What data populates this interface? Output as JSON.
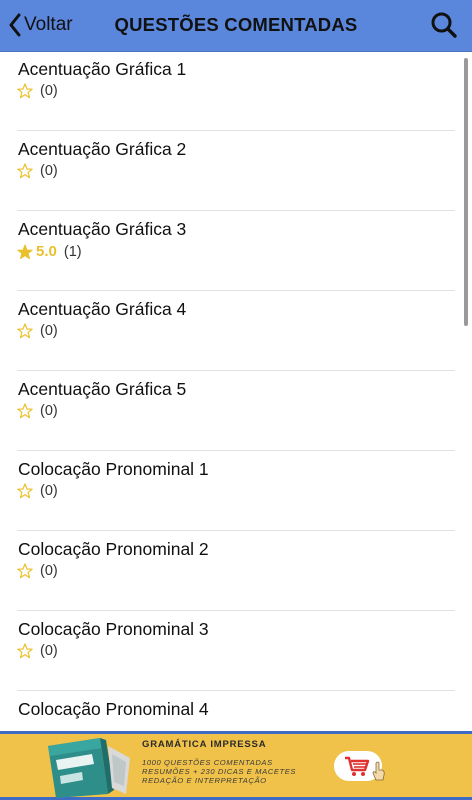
{
  "nav": {
    "back_label": "Voltar",
    "title": "QUESTÕES COMENTADAS"
  },
  "items": [
    {
      "title": "Acentuação Gráfica 1",
      "rating": null,
      "count": "(0)"
    },
    {
      "title": "Acentuação Gráfica 2",
      "rating": null,
      "count": "(0)"
    },
    {
      "title": "Acentuação Gráfica 3",
      "rating": "5.0",
      "count": "(1)"
    },
    {
      "title": "Acentuação Gráfica 4",
      "rating": null,
      "count": "(0)"
    },
    {
      "title": "Acentuação Gráfica 5",
      "rating": null,
      "count": "(0)"
    },
    {
      "title": "Colocação Pronominal 1",
      "rating": null,
      "count": "(0)"
    },
    {
      "title": "Colocação Pronominal 2",
      "rating": null,
      "count": "(0)"
    },
    {
      "title": "Colocação Pronominal 3",
      "rating": null,
      "count": "(0)"
    },
    {
      "title": "Colocação Pronominal 4",
      "rating": null,
      "count": ""
    }
  ],
  "banner": {
    "title": "GRAMÁTICA IMPRESSA",
    "line1": "1000 QUESTÕES COMENTADAS",
    "line2": "RESUMÕES + 230 DICAS E MACETES",
    "line3": "REDAÇÃO E INTERPRETAÇÃO"
  },
  "colors": {
    "navbar": "#5a86db",
    "star": "#e9c12e",
    "banner": "#f0c24a",
    "banner_border": "#3f6bc4",
    "cart": "#e03030"
  },
  "icons": {
    "back": "chevron-left-icon",
    "search": "search-icon",
    "empty_star": "star-outline-icon",
    "filled_star": "star-filled-icon",
    "cart": "shopping-cart-icon"
  }
}
